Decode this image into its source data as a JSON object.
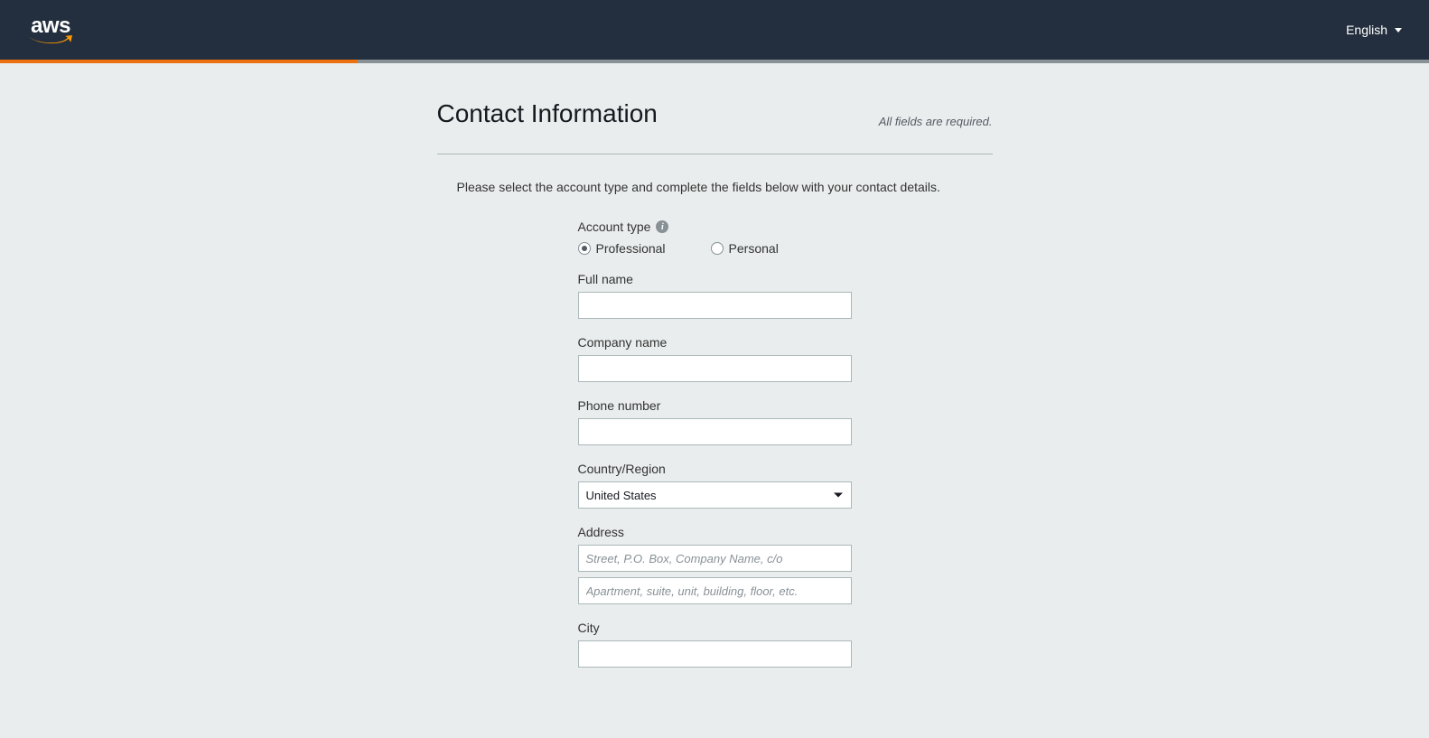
{
  "header": {
    "logo_alt": "aws",
    "language": "English"
  },
  "page": {
    "title": "Contact Information",
    "required_note": "All fields are required.",
    "instruction": "Please select the account type and complete the fields below with your contact details."
  },
  "form": {
    "account_type": {
      "label": "Account type",
      "options": {
        "professional": "Professional",
        "personal": "Personal"
      },
      "selected": "professional"
    },
    "full_name": {
      "label": "Full name",
      "value": ""
    },
    "company_name": {
      "label": "Company name",
      "value": ""
    },
    "phone_number": {
      "label": "Phone number",
      "value": ""
    },
    "country_region": {
      "label": "Country/Region",
      "value": "United States"
    },
    "address": {
      "label": "Address",
      "line1_placeholder": "Street, P.O. Box, Company Name, c/o",
      "line1_value": "",
      "line2_placeholder": "Apartment, suite, unit, building, floor, etc.",
      "line2_value": ""
    },
    "city": {
      "label": "City",
      "value": ""
    }
  }
}
